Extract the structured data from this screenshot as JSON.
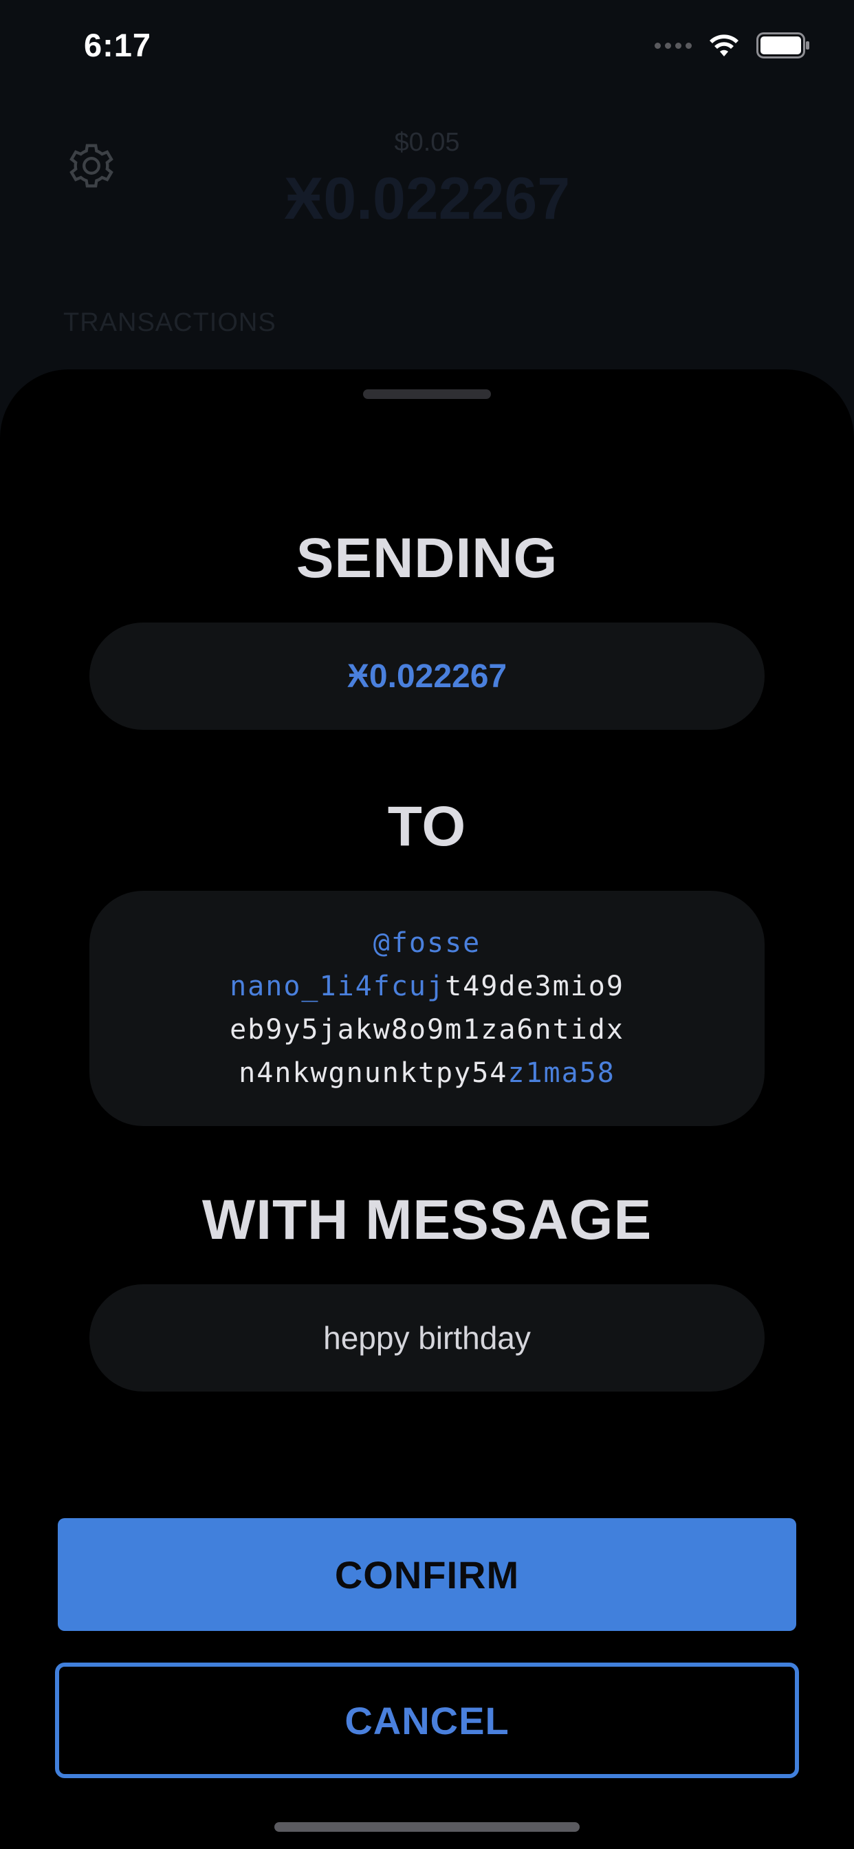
{
  "status_bar": {
    "time": "6:17"
  },
  "background": {
    "fiat_value": "$0.05",
    "balance": "Ӿ0.022267",
    "section_label": "TRANSACTIONS"
  },
  "sheet": {
    "sending_title": "SENDING",
    "amount": "Ӿ0.022267",
    "to_title": "TO",
    "recipient": {
      "username": "@fosse",
      "address_lines": [
        {
          "highlight": "nano_1i4fcuj",
          "plain": "t49de3mio9"
        },
        {
          "plain": "eb9y5jakw8o9m1za6ntidx"
        },
        {
          "plain": "n4nkwgnunktpy54",
          "highlight_end": "z1ma58"
        }
      ]
    },
    "message_title": "WITH MESSAGE",
    "message": "heppy birthday"
  },
  "actions": {
    "confirm_label": "CONFIRM",
    "cancel_label": "CANCEL"
  },
  "colors": {
    "accent": "#4180dc",
    "background": "#000000",
    "pill": "#111315"
  },
  "icons": {
    "settings": "gear-icon",
    "wifi": "wifi-icon",
    "battery": "battery-icon",
    "signal": "signal-icon"
  }
}
